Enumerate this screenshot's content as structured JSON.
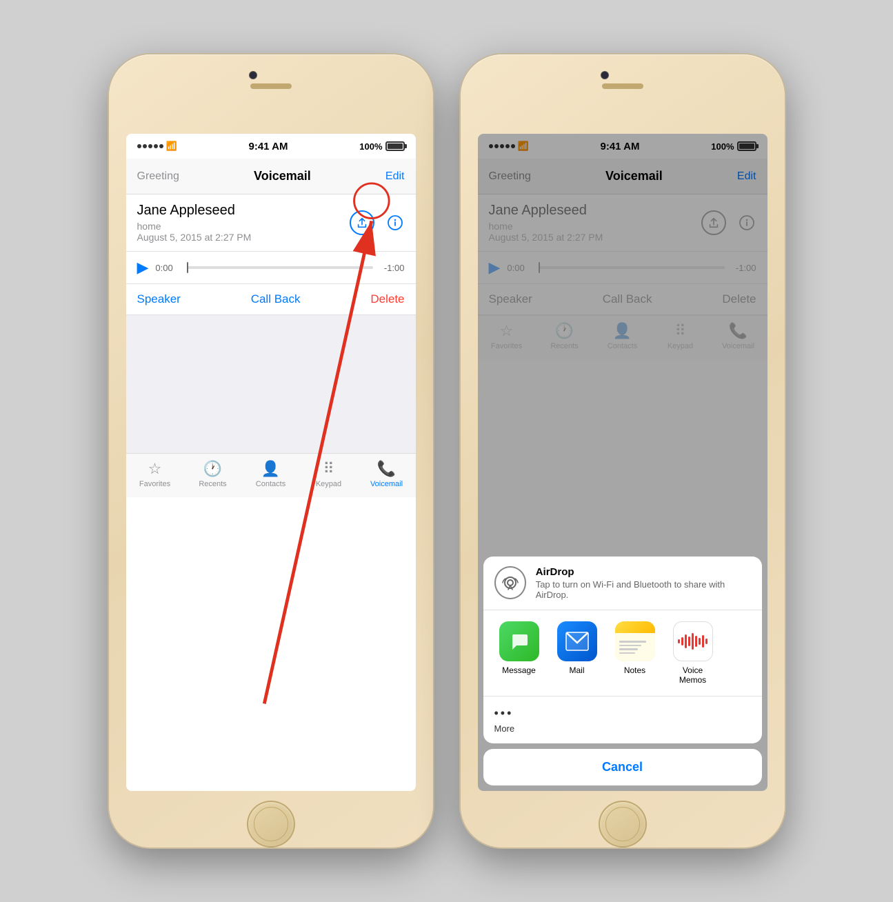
{
  "phone1": {
    "status": {
      "time": "9:41 AM",
      "battery": "100%"
    },
    "nav": {
      "left": "Greeting",
      "title": "Voicemail",
      "right": "Edit"
    },
    "voicemail": {
      "name": "Jane Appleseed",
      "type": "home",
      "date": "August 5, 2015 at 2:27 PM",
      "time_start": "0:00",
      "time_end": "-1:00"
    },
    "buttons": {
      "speaker": "Speaker",
      "callback": "Call Back",
      "delete": "Delete"
    },
    "tabs": [
      {
        "id": "favorites",
        "label": "Favorites",
        "active": false
      },
      {
        "id": "recents",
        "label": "Recents",
        "active": false
      },
      {
        "id": "contacts",
        "label": "Contacts",
        "active": false
      },
      {
        "id": "keypad",
        "label": "Keypad",
        "active": false
      },
      {
        "id": "voicemail",
        "label": "Voicemail",
        "active": true
      }
    ]
  },
  "phone2": {
    "status": {
      "time": "9:41 AM",
      "battery": "100%"
    },
    "nav": {
      "left": "Greeting",
      "title": "Voicemail",
      "right": "Edit"
    },
    "voicemail": {
      "name": "Jane Appleseed",
      "type": "home",
      "date": "August 5, 2015 at 2:27 PM",
      "time_start": "0:00",
      "time_end": "-1:00"
    },
    "buttons": {
      "speaker": "Speaker",
      "callback": "Call Back",
      "delete": "Delete"
    },
    "share_sheet": {
      "airdrop_title": "AirDrop",
      "airdrop_desc": "Tap to turn on Wi-Fi and Bluetooth to share with AirDrop.",
      "apps": [
        {
          "id": "messages",
          "label": "Message"
        },
        {
          "id": "mail",
          "label": "Mail"
        },
        {
          "id": "notes",
          "label": "Notes"
        },
        {
          "id": "voicememos",
          "label": "Voice Memos"
        }
      ],
      "more_label": "More",
      "cancel_label": "Cancel"
    },
    "tabs": [
      {
        "id": "favorites",
        "label": "Favorites",
        "active": false
      },
      {
        "id": "recents",
        "label": "Recents",
        "active": false
      },
      {
        "id": "contacts",
        "label": "Contacts",
        "active": false
      },
      {
        "id": "keypad",
        "label": "Keypad",
        "active": false
      },
      {
        "id": "voicemail",
        "label": "Voicemail",
        "active": false
      }
    ]
  }
}
